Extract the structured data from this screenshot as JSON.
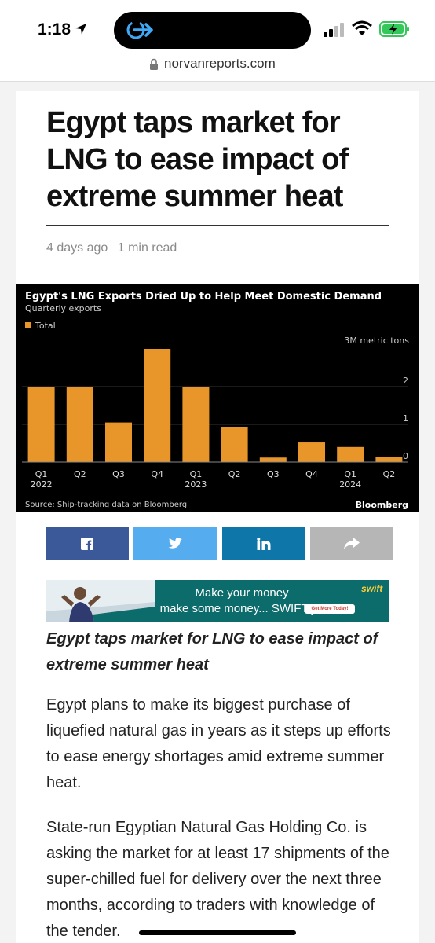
{
  "status_bar": {
    "time": "1:18"
  },
  "browser": {
    "url": "norvanreports.com"
  },
  "article": {
    "headline": "Egypt taps market for LNG to ease impact of extreme summer heat",
    "meta": {
      "age": "4 days ago",
      "read_time": "1 min read"
    },
    "subhead": "Egypt taps market for LNG to ease impact of extreme summer heat",
    "paragraphs": [
      "Egypt plans to make its biggest purchase of liquefied natural gas in years as it steps up efforts to ease energy shortages amid extreme summer heat.",
      "State-run Egyptian Natural Gas Holding Co. is asking the market for at least 17 shipments of the super-chilled fuel for delivery over the next three months, according to traders with knowledge of the tender."
    ]
  },
  "share": {
    "buttons": [
      {
        "name": "facebook",
        "icon": "facebook-icon"
      },
      {
        "name": "twitter",
        "icon": "twitter-icon"
      },
      {
        "name": "linkedin",
        "icon": "linkedin-icon"
      },
      {
        "name": "more",
        "icon": "share-arrow-icon"
      }
    ],
    "colors": {
      "facebook": "#3b5998",
      "twitter": "#55acee",
      "linkedin": "#0e76a8",
      "more": "#b6b6b6"
    }
  },
  "ad": {
    "line1": "Make your money",
    "line2": "make some money... SWIFTly",
    "cta": "Get More Today!",
    "logo": "swift",
    "background": "#0c6b6b"
  },
  "chart_data": {
    "type": "bar",
    "title": "Egypt's LNG Exports Dried Up to Help Meet Domestic Demand",
    "subtitle": "Quarterly exports",
    "unit_label": "3M metric tons",
    "source": "Source: Ship-tracking data on Bloomberg",
    "brand": "Bloomberg",
    "series": [
      {
        "name": "Total",
        "color": "#e8962a",
        "values": [
          2.0,
          2.0,
          1.05,
          3.0,
          2.0,
          0.92,
          0.12,
          0.52,
          0.4,
          0.14
        ]
      }
    ],
    "categories": [
      "Q1",
      "Q2",
      "Q3",
      "Q4",
      "Q1",
      "Q2",
      "Q3",
      "Q4",
      "Q1",
      "Q2"
    ],
    "year_labels": [
      "2022",
      "",
      "",
      "",
      "2023",
      "",
      "",
      "",
      "2024",
      ""
    ],
    "y_ticks": [
      "0",
      "1",
      "2"
    ],
    "ylim": [
      0,
      3
    ],
    "grid": true,
    "legend_position": "top-left"
  }
}
